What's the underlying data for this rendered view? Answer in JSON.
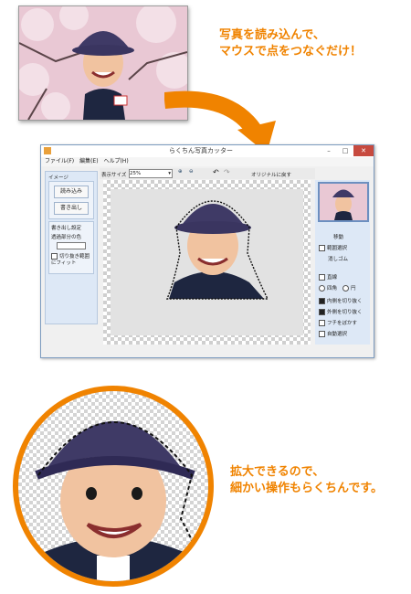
{
  "callouts": {
    "top_line1": "写真を読み込んで、",
    "top_line2": "マウスで点をつなぐだけ！",
    "bottom_line1": "拡大できるので、",
    "bottom_line2": "細かい操作もらくちんです。"
  },
  "window": {
    "title": "らくちん写真カッター",
    "menu": [
      "ファイル(F)",
      "編集(E)",
      "ヘルプ(H)"
    ],
    "toolbar": {
      "display_size_label": "表示サイズ",
      "display_size_value": "25%",
      "revert_label": "オリジナルに戻す"
    },
    "left_panel": {
      "image_section": "イメージ",
      "load_button": "読み込み",
      "save_button": "書き出し",
      "export_settings": "書き出し設定",
      "transparent_color_label": "透過部分の色",
      "fit_label": "切り抜き範囲にフィット"
    },
    "right_panel": {
      "move_label": "移動",
      "range_select": "範囲選択",
      "eraser": "消しゴム",
      "line_label": "直線",
      "rect": "四角",
      "circle": "円",
      "inside_cut": "内側を切り抜く",
      "outside_cut": "外側を切り抜く",
      "edge_blur": "フチをぼかす",
      "auto_select": "自動選択"
    }
  },
  "colors": {
    "accent": "#f08300",
    "window_border": "#7c9bbf",
    "panel_bg": "#dde8f6"
  }
}
